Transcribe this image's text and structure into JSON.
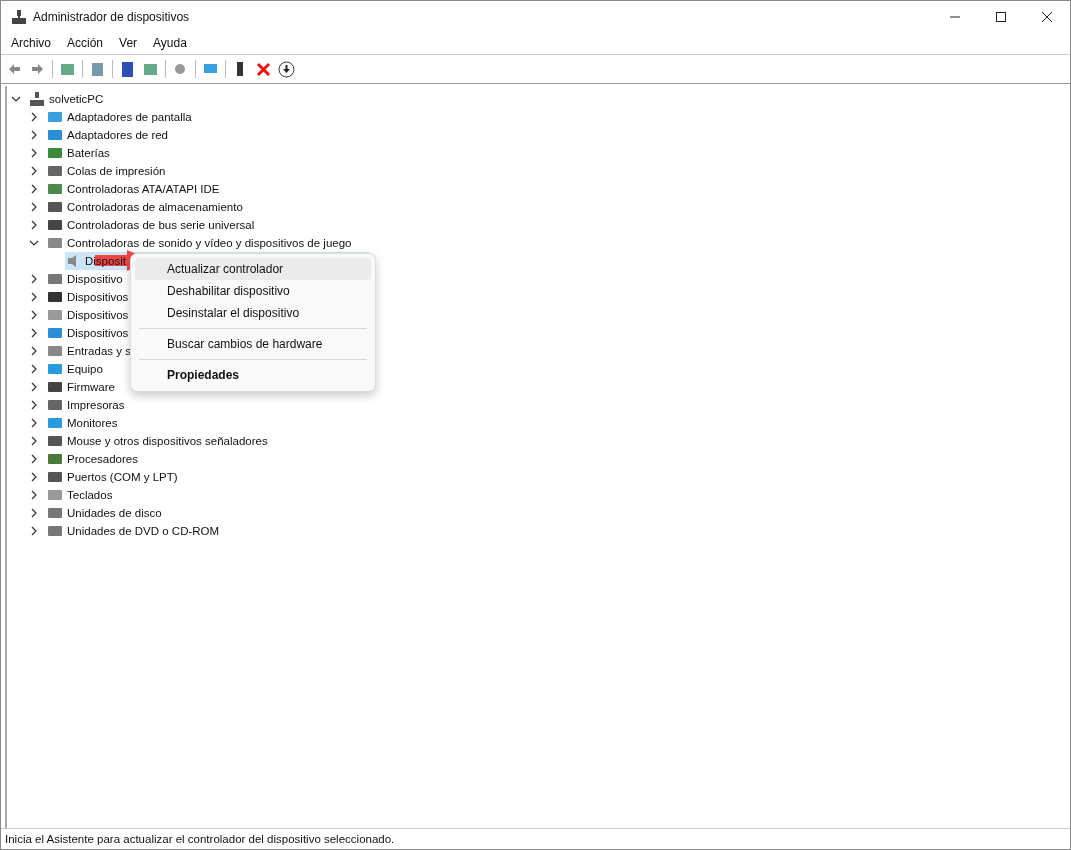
{
  "window": {
    "title": "Administrador de dispositivos"
  },
  "menu_bar": [
    "Archivo",
    "Acción",
    "Ver",
    "Ayuda"
  ],
  "tree": {
    "label": "solveticPC",
    "expanded": true,
    "children": [
      {
        "label": "Adaptadores de pantalla",
        "expanded": false
      },
      {
        "label": "Adaptadores de red",
        "expanded": false
      },
      {
        "label": "Baterías",
        "expanded": false
      },
      {
        "label": "Colas de impresión",
        "expanded": false
      },
      {
        "label": "Controladoras ATA/ATAPI IDE",
        "expanded": false
      },
      {
        "label": "Controladoras de almacenamiento",
        "expanded": false
      },
      {
        "label": "Controladoras de bus serie universal",
        "expanded": false
      },
      {
        "label": "Controladoras de sonido y vídeo y dispositivos de juego",
        "expanded": true,
        "children": [
          {
            "label": "Disposit",
            "selected": true
          }
        ]
      },
      {
        "label": "Dispositivo",
        "expanded": false
      },
      {
        "label": "Dispositivos",
        "expanded": false
      },
      {
        "label": "Dispositivos",
        "expanded": false
      },
      {
        "label": "Dispositivos",
        "expanded": false
      },
      {
        "label": "Entradas y s",
        "expanded": false
      },
      {
        "label": "Equipo",
        "expanded": false
      },
      {
        "label": "Firmware",
        "expanded": false
      },
      {
        "label": "Impresoras",
        "expanded": false
      },
      {
        "label": "Monitores",
        "expanded": false
      },
      {
        "label": "Mouse y otros dispositivos señaladores",
        "expanded": false
      },
      {
        "label": "Procesadores",
        "expanded": false
      },
      {
        "label": "Puertos (COM y LPT)",
        "expanded": false
      },
      {
        "label": "Teclados",
        "expanded": false
      },
      {
        "label": "Unidades de disco",
        "expanded": false
      },
      {
        "label": "Unidades de DVD o CD-ROM",
        "expanded": false
      }
    ]
  },
  "context_menu": [
    {
      "kind": "item",
      "label": "Actualizar controlador",
      "highlighted": true,
      "default": false
    },
    {
      "kind": "item",
      "label": "Deshabilitar dispositivo",
      "highlighted": false,
      "default": false
    },
    {
      "kind": "item",
      "label": "Desinstalar el dispositivo",
      "highlighted": false,
      "default": false
    },
    {
      "kind": "separator"
    },
    {
      "kind": "item",
      "label": "Buscar cambios de hardware",
      "highlighted": false,
      "default": false
    },
    {
      "kind": "separator"
    },
    {
      "kind": "item",
      "label": "Propiedades",
      "highlighted": false,
      "default": true
    }
  ],
  "status_bar": "Inicia el Asistente para actualizar el controlador del dispositivo seleccionado."
}
